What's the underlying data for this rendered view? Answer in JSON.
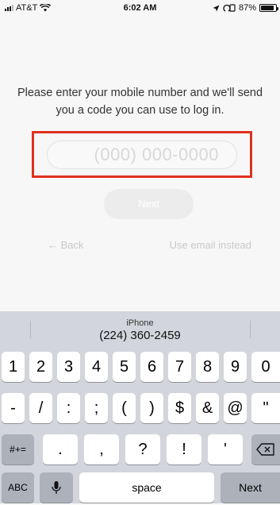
{
  "status_bar": {
    "carrier": "AT&T",
    "time": "6:02 AM",
    "battery": "87%",
    "battery_level": 0.87
  },
  "login": {
    "prompt": "Please enter your mobile number and we'll send you a code you can use to log in.",
    "phone_placeholder": "(000) 000-0000",
    "next_label": "Next",
    "back_label": "← Back",
    "email_label": "Use email instead"
  },
  "keyboard": {
    "suggestion_title": "iPhone",
    "suggestion_number": "(224) 360-2459",
    "row1": [
      "1",
      "2",
      "3",
      "4",
      "5",
      "6",
      "7",
      "8",
      "9",
      "0"
    ],
    "row2": [
      "-",
      "/",
      ":",
      ";",
      "(",
      ")",
      "$",
      "&",
      "@",
      "\""
    ],
    "row3_left": "#+=",
    "row3": [
      ".",
      ",",
      "?",
      "!",
      "'"
    ],
    "row4_abc": "ABC",
    "row4_space": "space",
    "row4_next": "Next"
  },
  "colors": {
    "highlight": "#e0301e",
    "background": "#f7f7f7",
    "keyboard": "#d2d5db"
  }
}
